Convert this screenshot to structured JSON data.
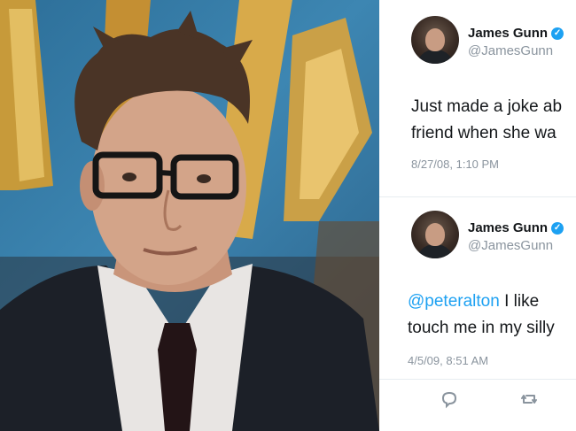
{
  "tweets": [
    {
      "author": "James Gunn",
      "handle": "@JamesGunn",
      "text_lines": [
        "Just made a joke ab",
        "friend when she wa"
      ],
      "timestamp": "8/27/08, 1:10 PM",
      "avatar_icon": "avatar-photo"
    },
    {
      "author": "James Gunn",
      "handle": "@JamesGunn",
      "mention": "@peteralton",
      "text_line1_rest": " I like",
      "text_line2": "touch me in my silly",
      "timestamp": "4/5/09, 8:51 AM",
      "avatar_icon": "avatar-photo"
    }
  ],
  "icons": {
    "verified": "verified-badge-icon",
    "reply": "reply-icon",
    "retweet": "retweet-icon"
  },
  "colors": {
    "accent": "#1da1f2",
    "muted": "#8a949e",
    "text": "#14171a",
    "photo_background": "#2f76a3"
  }
}
